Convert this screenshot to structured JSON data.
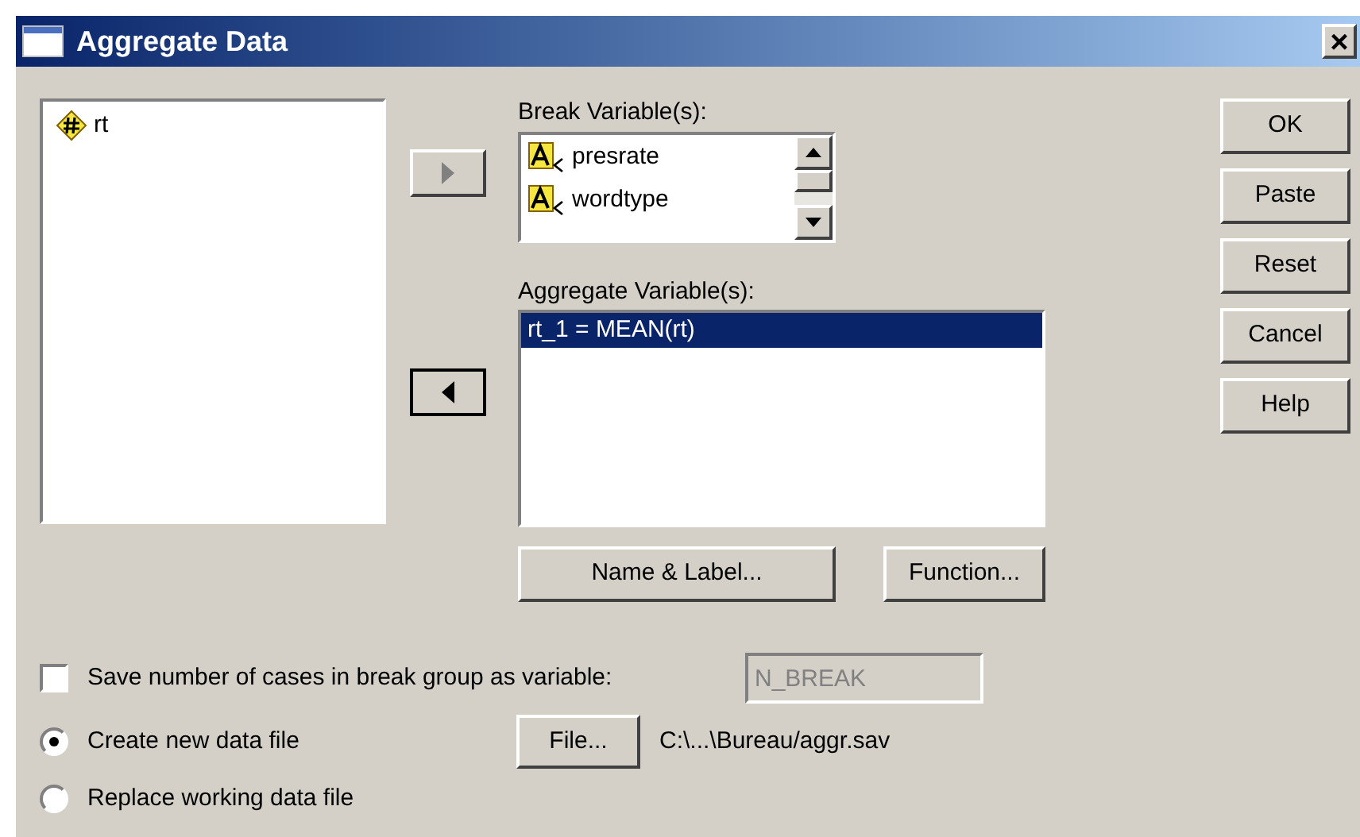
{
  "window": {
    "title": "Aggregate Data",
    "close": "×"
  },
  "source_list": {
    "items": [
      {
        "label": "rt",
        "kind": "scale",
        "selected": false
      }
    ]
  },
  "move_buttons": [
    {
      "kind": "right",
      "disabled": true
    },
    {
      "kind": "left",
      "disabled": false
    }
  ],
  "break_variables": {
    "label": "Break Variable(s):",
    "items": [
      {
        "label": "presrate",
        "kind": "nominal",
        "selected": false
      },
      {
        "label": "wordtype",
        "kind": "nominal",
        "selected": false
      }
    ]
  },
  "aggregate_variables": {
    "label": "Aggregate Variable(s):",
    "items": [
      {
        "label": "rt_1 = MEAN(rt)",
        "selected": true
      }
    ]
  },
  "aggregate_buttons": [
    "Name & Label...",
    "Function..."
  ],
  "side_buttons": [
    "OK",
    "Paste",
    "Reset",
    "Cancel",
    "Help"
  ],
  "save_count": {
    "label": "Save number of cases in break group as variable:",
    "checked": false,
    "value": "N_BREAK",
    "disabled": true
  },
  "output_options": [
    {
      "label": "Create new data file",
      "selected": true
    },
    {
      "label": "Replace working data file",
      "selected": false
    }
  ],
  "file_button": "File...",
  "file_path": "C:\\...\\Bureau/aggr.sav"
}
